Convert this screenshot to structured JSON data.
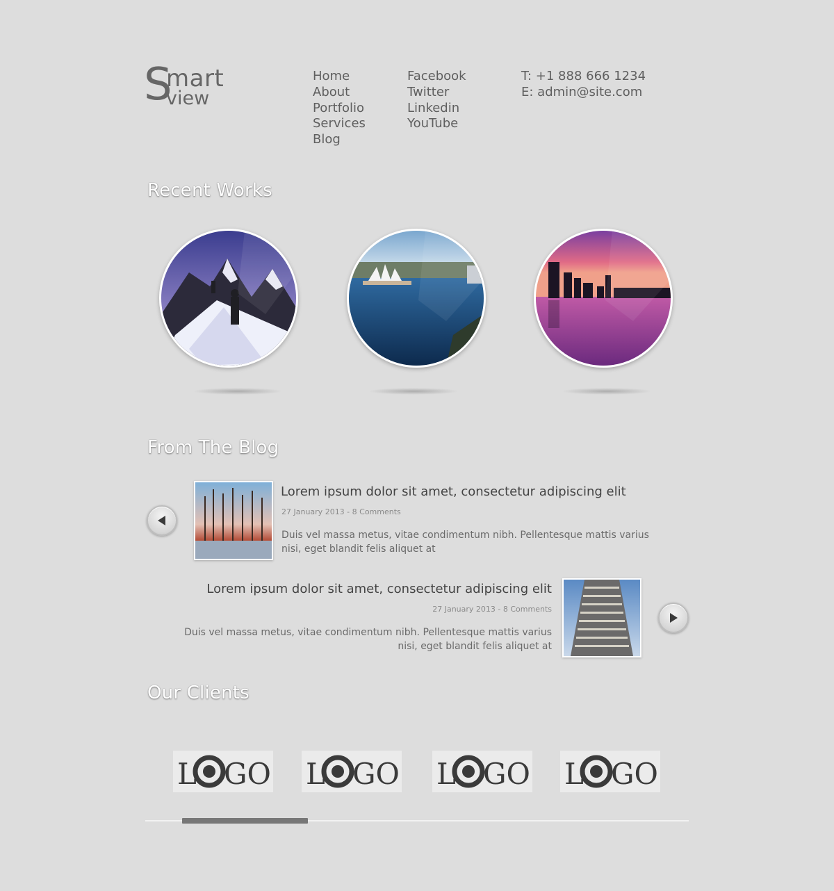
{
  "brand": {
    "big_letter": "S",
    "word1": "mart",
    "word2": "view"
  },
  "nav": {
    "main": [
      "Home",
      "About",
      "Portfolio",
      "Services",
      "Blog"
    ],
    "social": [
      "Facebook",
      "Twitter",
      "Linkedin",
      "YouTube"
    ]
  },
  "contact": {
    "phone": "T: +1 888 666 1234",
    "email": "E: admin@site.com"
  },
  "sections": {
    "recent_works": "Recent Works",
    "blog": "From The Blog",
    "clients": "Our Clients"
  },
  "works": [
    {
      "subject": "snowy-mountain-climbers"
    },
    {
      "subject": "sydney-opera-house"
    },
    {
      "subject": "city-skyline-sunset"
    }
  ],
  "posts": [
    {
      "title": "Lorem ipsum dolor sit amet, consectetur adipiscing elit",
      "meta": "27 January 2013 - 8 Comments",
      "excerpt": "Duis vel massa metus, vitae condimentum nibh. Pellentesque mattis varius nisi, eget blandit felis aliquet at"
    },
    {
      "title": "Lorem ipsum dolor sit amet, consectetur adipiscing elit",
      "meta": "27 January 2013 - 8 Comments",
      "excerpt": "Duis vel massa metus, vitae condimentum nibh. Pellentesque mattis varius nisi, eget blandit felis aliquet at"
    }
  ],
  "clients": [
    {
      "text_l": "L",
      "text_go": "GO"
    },
    {
      "text_l": "L",
      "text_go": "GO"
    },
    {
      "text_l": "L",
      "text_go": "GO"
    },
    {
      "text_l": "L",
      "text_go": "GO"
    }
  ],
  "icons": {
    "prev": "arrow-left-icon",
    "next": "arrow-right-icon"
  },
  "colors": {
    "background": "#dddddd",
    "text": "#5f5f5f",
    "heading": "#ffffff"
  }
}
